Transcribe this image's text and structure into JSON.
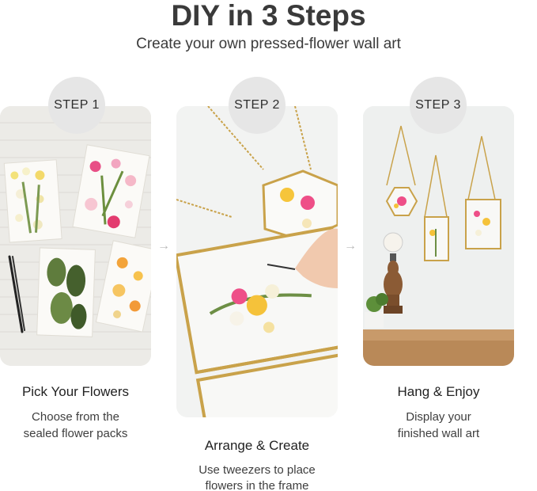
{
  "header": {
    "title": "DIY in 3 Steps",
    "subtitle": "Create your own pressed-flower wall art"
  },
  "steps": [
    {
      "badge": "STEP 1",
      "heading": "Pick Your Flowers",
      "description_line1": "Choose from the",
      "description_line2": "sealed flower packs"
    },
    {
      "badge": "STEP 2",
      "heading": "Arrange & Create",
      "description_line1": "Use tweezers to place",
      "description_line2": "flowers in the frame"
    },
    {
      "badge": "STEP 3",
      "heading": "Hang & Enjoy",
      "description_line1": "Display your",
      "description_line2": "finished wall art"
    }
  ],
  "arrow_glyph": "→",
  "colors": {
    "badge_bg": "#e6e6e6",
    "gold_frame": "#c9a24a",
    "wall": "#eef0ee",
    "table": "#c89a6a"
  }
}
